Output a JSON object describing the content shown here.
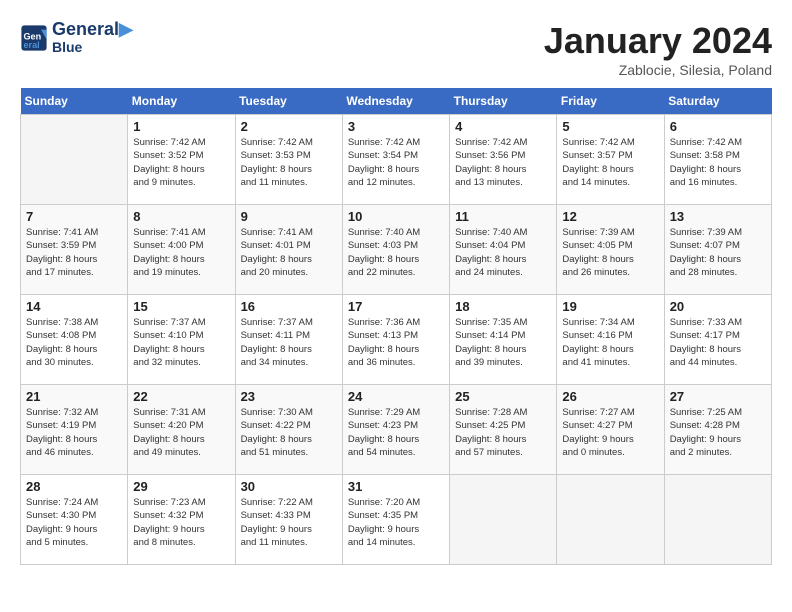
{
  "header": {
    "logo_line1": "General",
    "logo_line2": "Blue",
    "month": "January 2024",
    "location": "Zablocie, Silesia, Poland"
  },
  "days_of_week": [
    "Sunday",
    "Monday",
    "Tuesday",
    "Wednesday",
    "Thursday",
    "Friday",
    "Saturday"
  ],
  "weeks": [
    [
      {
        "day": "",
        "info": ""
      },
      {
        "day": "1",
        "info": "Sunrise: 7:42 AM\nSunset: 3:52 PM\nDaylight: 8 hours\nand 9 minutes."
      },
      {
        "day": "2",
        "info": "Sunrise: 7:42 AM\nSunset: 3:53 PM\nDaylight: 8 hours\nand 11 minutes."
      },
      {
        "day": "3",
        "info": "Sunrise: 7:42 AM\nSunset: 3:54 PM\nDaylight: 8 hours\nand 12 minutes."
      },
      {
        "day": "4",
        "info": "Sunrise: 7:42 AM\nSunset: 3:56 PM\nDaylight: 8 hours\nand 13 minutes."
      },
      {
        "day": "5",
        "info": "Sunrise: 7:42 AM\nSunset: 3:57 PM\nDaylight: 8 hours\nand 14 minutes."
      },
      {
        "day": "6",
        "info": "Sunrise: 7:42 AM\nSunset: 3:58 PM\nDaylight: 8 hours\nand 16 minutes."
      }
    ],
    [
      {
        "day": "7",
        "info": "Sunrise: 7:41 AM\nSunset: 3:59 PM\nDaylight: 8 hours\nand 17 minutes."
      },
      {
        "day": "8",
        "info": "Sunrise: 7:41 AM\nSunset: 4:00 PM\nDaylight: 8 hours\nand 19 minutes."
      },
      {
        "day": "9",
        "info": "Sunrise: 7:41 AM\nSunset: 4:01 PM\nDaylight: 8 hours\nand 20 minutes."
      },
      {
        "day": "10",
        "info": "Sunrise: 7:40 AM\nSunset: 4:03 PM\nDaylight: 8 hours\nand 22 minutes."
      },
      {
        "day": "11",
        "info": "Sunrise: 7:40 AM\nSunset: 4:04 PM\nDaylight: 8 hours\nand 24 minutes."
      },
      {
        "day": "12",
        "info": "Sunrise: 7:39 AM\nSunset: 4:05 PM\nDaylight: 8 hours\nand 26 minutes."
      },
      {
        "day": "13",
        "info": "Sunrise: 7:39 AM\nSunset: 4:07 PM\nDaylight: 8 hours\nand 28 minutes."
      }
    ],
    [
      {
        "day": "14",
        "info": "Sunrise: 7:38 AM\nSunset: 4:08 PM\nDaylight: 8 hours\nand 30 minutes."
      },
      {
        "day": "15",
        "info": "Sunrise: 7:37 AM\nSunset: 4:10 PM\nDaylight: 8 hours\nand 32 minutes."
      },
      {
        "day": "16",
        "info": "Sunrise: 7:37 AM\nSunset: 4:11 PM\nDaylight: 8 hours\nand 34 minutes."
      },
      {
        "day": "17",
        "info": "Sunrise: 7:36 AM\nSunset: 4:13 PM\nDaylight: 8 hours\nand 36 minutes."
      },
      {
        "day": "18",
        "info": "Sunrise: 7:35 AM\nSunset: 4:14 PM\nDaylight: 8 hours\nand 39 minutes."
      },
      {
        "day": "19",
        "info": "Sunrise: 7:34 AM\nSunset: 4:16 PM\nDaylight: 8 hours\nand 41 minutes."
      },
      {
        "day": "20",
        "info": "Sunrise: 7:33 AM\nSunset: 4:17 PM\nDaylight: 8 hours\nand 44 minutes."
      }
    ],
    [
      {
        "day": "21",
        "info": "Sunrise: 7:32 AM\nSunset: 4:19 PM\nDaylight: 8 hours\nand 46 minutes."
      },
      {
        "day": "22",
        "info": "Sunrise: 7:31 AM\nSunset: 4:20 PM\nDaylight: 8 hours\nand 49 minutes."
      },
      {
        "day": "23",
        "info": "Sunrise: 7:30 AM\nSunset: 4:22 PM\nDaylight: 8 hours\nand 51 minutes."
      },
      {
        "day": "24",
        "info": "Sunrise: 7:29 AM\nSunset: 4:23 PM\nDaylight: 8 hours\nand 54 minutes."
      },
      {
        "day": "25",
        "info": "Sunrise: 7:28 AM\nSunset: 4:25 PM\nDaylight: 8 hours\nand 57 minutes."
      },
      {
        "day": "26",
        "info": "Sunrise: 7:27 AM\nSunset: 4:27 PM\nDaylight: 9 hours\nand 0 minutes."
      },
      {
        "day": "27",
        "info": "Sunrise: 7:25 AM\nSunset: 4:28 PM\nDaylight: 9 hours\nand 2 minutes."
      }
    ],
    [
      {
        "day": "28",
        "info": "Sunrise: 7:24 AM\nSunset: 4:30 PM\nDaylight: 9 hours\nand 5 minutes."
      },
      {
        "day": "29",
        "info": "Sunrise: 7:23 AM\nSunset: 4:32 PM\nDaylight: 9 hours\nand 8 minutes."
      },
      {
        "day": "30",
        "info": "Sunrise: 7:22 AM\nSunset: 4:33 PM\nDaylight: 9 hours\nand 11 minutes."
      },
      {
        "day": "31",
        "info": "Sunrise: 7:20 AM\nSunset: 4:35 PM\nDaylight: 9 hours\nand 14 minutes."
      },
      {
        "day": "",
        "info": ""
      },
      {
        "day": "",
        "info": ""
      },
      {
        "day": "",
        "info": ""
      }
    ]
  ]
}
